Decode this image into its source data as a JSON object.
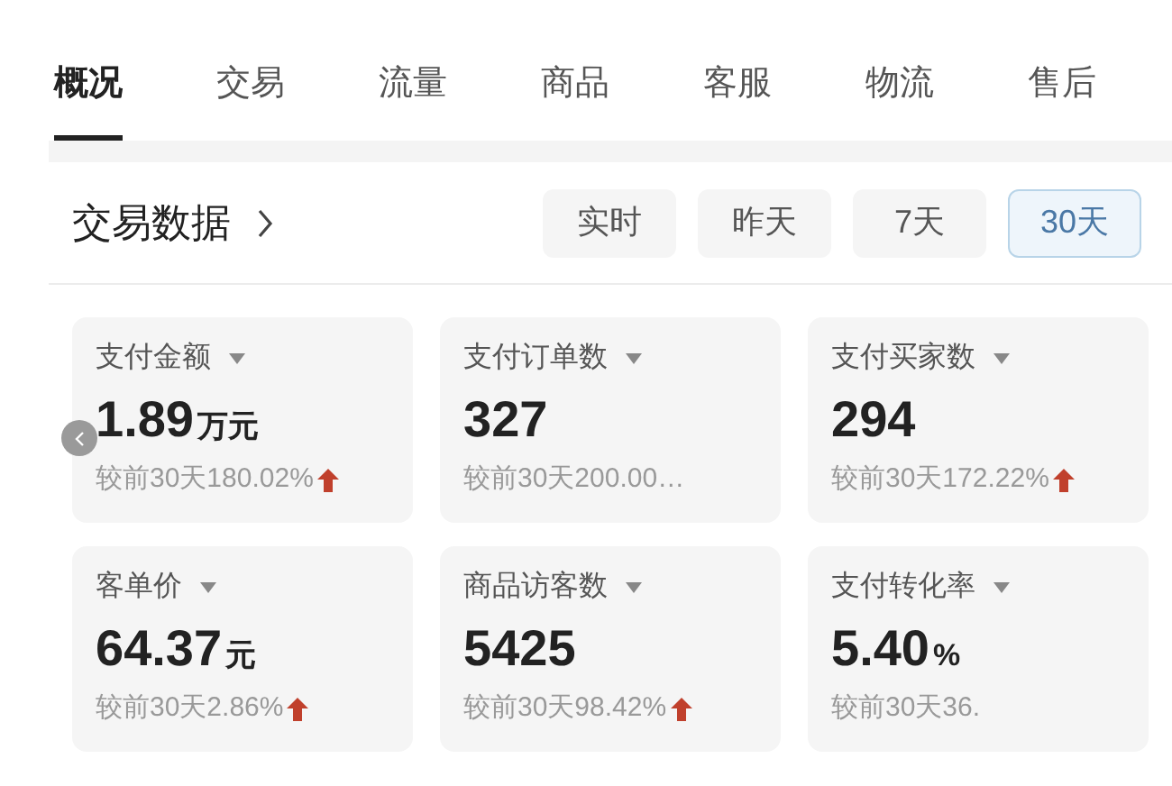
{
  "tabs": [
    {
      "label": "概况",
      "selected": true
    },
    {
      "label": "交易",
      "selected": false
    },
    {
      "label": "流量",
      "selected": false
    },
    {
      "label": "商品",
      "selected": false
    },
    {
      "label": "客服",
      "selected": false
    },
    {
      "label": "物流",
      "selected": false
    },
    {
      "label": "售后",
      "selected": false
    }
  ],
  "section": {
    "title": "交易数据",
    "ranges": [
      {
        "label": "实时",
        "selected": false
      },
      {
        "label": "昨天",
        "selected": false
      },
      {
        "label": "7天",
        "selected": false
      },
      {
        "label": "30天",
        "selected": true
      }
    ]
  },
  "metrics": [
    {
      "label": "支付金额",
      "value": "1.89",
      "unit": "万元",
      "compare": "较前30天180.02%",
      "increased": true
    },
    {
      "label": "支付订单数",
      "value": "327",
      "compare": "较前30天200.00…",
      "increased": false
    },
    {
      "label": "支付买家数",
      "value": "294",
      "compare": "较前30天172.22%",
      "increased": true
    },
    {
      "label": "客单价",
      "value": "64.37",
      "unit": "元",
      "compare": "较前30天2.86%",
      "increased": true
    },
    {
      "label": "商品访客数",
      "value": "5425",
      "compare": "较前30天98.42%",
      "increased": true
    },
    {
      "label": "支付转化率",
      "value": "5.40",
      "unit": "%",
      "compare": "较前30天36.",
      "increased": false
    }
  ]
}
